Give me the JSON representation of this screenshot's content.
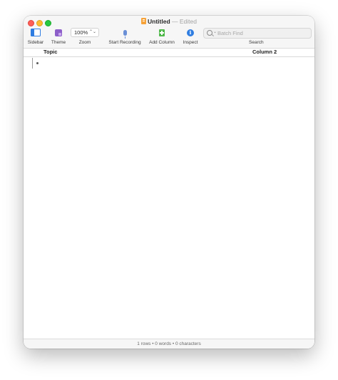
{
  "window": {
    "title": "Untitled",
    "separator": "—",
    "status": "Edited"
  },
  "toolbar": {
    "sidebar_label": "Sidebar",
    "theme_label": "Theme",
    "zoom_value": "100%",
    "zoom_label": "Zoom",
    "record_label": "Start Recording",
    "add_column_label": "Add Column",
    "inspect_label": "Inspect",
    "search_placeholder": "Batch Find",
    "search_label": "Search"
  },
  "outline": {
    "columns": [
      "Topic",
      "Column 2"
    ],
    "rows": [
      {
        "topic": "",
        "column2": ""
      }
    ]
  },
  "statusbar": {
    "text": "1 rows • 0 words • 0 characters"
  },
  "colors": {
    "close": "#fe5f57",
    "minimize": "#febc2e",
    "maximize": "#28c840",
    "accent_blue": "#2f7de1",
    "theme_purple": "#8d5fc9",
    "add_green": "#4fb84a"
  },
  "icons": [
    "sidebar-icon",
    "theme-icon",
    "microphone-icon",
    "add-column-icon",
    "info-icon",
    "search-icon",
    "document-icon"
  ]
}
